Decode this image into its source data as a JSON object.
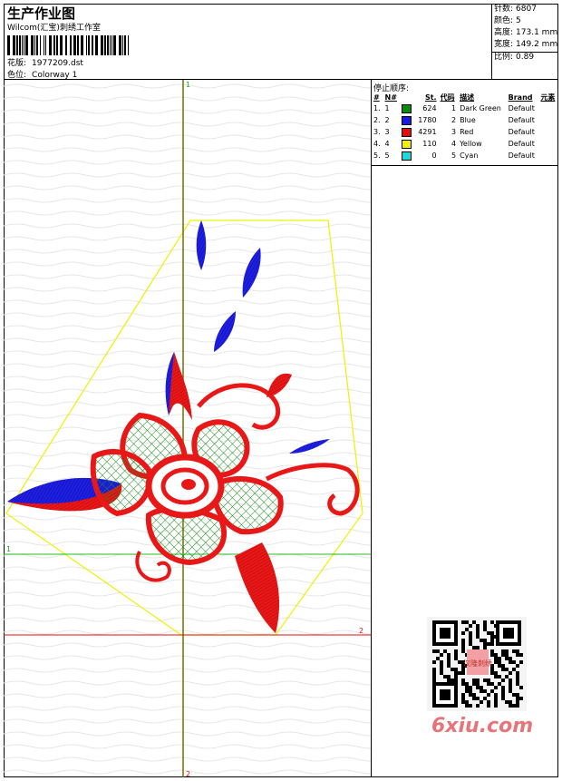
{
  "header": {
    "title": "生产作业图",
    "company": "Wilcom(汇宝)刺绣工作室",
    "file_label": "花版:",
    "file_value": "1977209.dst",
    "colorway_label": "色位:",
    "colorway_value": "Colorway 1"
  },
  "stats": [
    {
      "label": "针数:",
      "value": "6807"
    },
    {
      "label": "颜色:",
      "value": "5"
    },
    {
      "label": "高度:",
      "value": "173.1 mm"
    },
    {
      "label": "宽度:",
      "value": "149.2 mm"
    },
    {
      "label": "比例:",
      "value": "0.89"
    }
  ],
  "stop_sequence": {
    "title": "停止顺序:",
    "columns": [
      "#",
      "N#",
      "St.",
      "代码",
      "描述",
      "Brand",
      "元素"
    ],
    "rows": [
      {
        "idx": "1.",
        "num": "1",
        "color": "#0a8a0a",
        "stitches": "624",
        "code": "1",
        "desc": "Dark Green",
        "brand": "Default"
      },
      {
        "idx": "2.",
        "num": "2",
        "color": "#1a1adc",
        "stitches": "1780",
        "code": "2",
        "desc": "Blue",
        "brand": "Default"
      },
      {
        "idx": "3.",
        "num": "3",
        "color": "#e01010",
        "stitches": "4291",
        "code": "3",
        "desc": "Red",
        "brand": "Default"
      },
      {
        "idx": "4.",
        "num": "4",
        "color": "#f0f000",
        "stitches": "110",
        "code": "4",
        "desc": "Yellow",
        "brand": "Default"
      },
      {
        "idx": "5.",
        "num": "5",
        "color": "#20d8d8",
        "stitches": "0",
        "code": "5",
        "desc": "Cyan",
        "brand": "Default"
      }
    ]
  },
  "canvas": {
    "axis_v_top": "1",
    "axis_v_bottom": "2",
    "axis_h_left": "1",
    "axis_h_right": "2"
  },
  "watermark": "6xiu.com",
  "qr_label": "汉隆刺绣"
}
